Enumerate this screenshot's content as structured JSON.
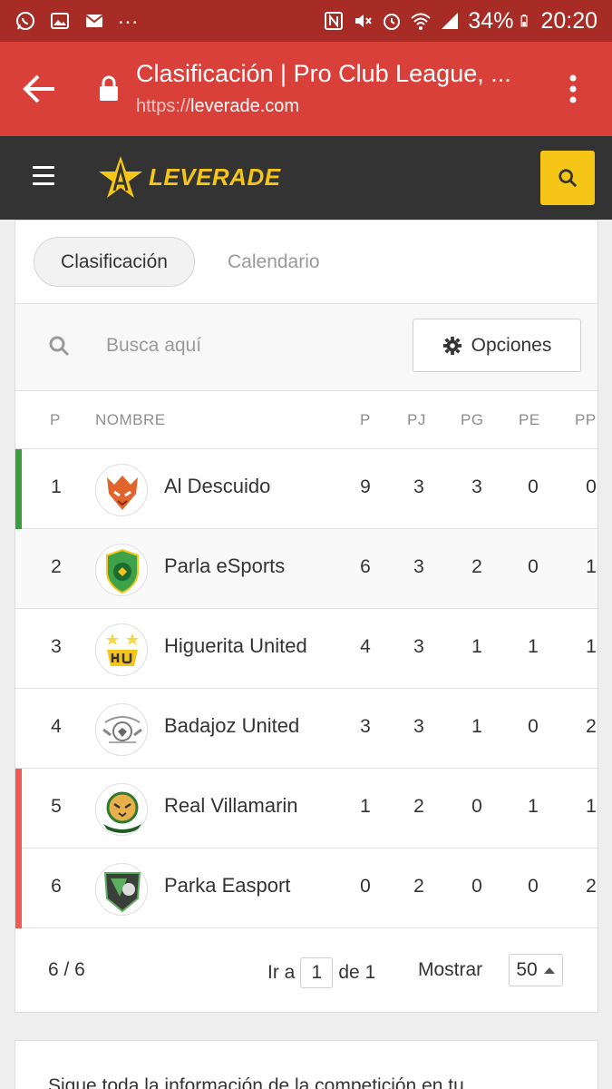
{
  "status": {
    "battery": "34%",
    "time": "20:20",
    "dots": "..."
  },
  "browser": {
    "title": "Clasificación | Pro Club League, ...",
    "url_scheme": "https://",
    "url_host": "leverade.com"
  },
  "site": {
    "logo_text": "LEVERADE",
    "accent": "#f5c518"
  },
  "tabs": [
    {
      "label": "Clasificación"
    },
    {
      "label": "Calendario"
    }
  ],
  "search": {
    "placeholder": "Busca aquí"
  },
  "options": {
    "label": "Opciones"
  },
  "table": {
    "headers": [
      "P",
      "NOMBRE",
      "P",
      "PJ",
      "PG",
      "PE",
      "PP"
    ],
    "rows": [
      {
        "pos": "1",
        "name": "Al Descuido",
        "p": "9",
        "pj": "3",
        "pg": "3",
        "pe": "0",
        "pp": "0",
        "zone": "#3a9c3a",
        "crest": "tiger"
      },
      {
        "pos": "2",
        "name": "Parla eSports",
        "p": "6",
        "pj": "3",
        "pg": "2",
        "pe": "0",
        "pp": "1",
        "zone": "",
        "crest": "shield-green"
      },
      {
        "pos": "3",
        "name": "Higuerita United",
        "p": "4",
        "pj": "3",
        "pg": "1",
        "pe": "1",
        "pp": "1",
        "zone": "",
        "crest": "hu-badge"
      },
      {
        "pos": "4",
        "name": "Badajoz United",
        "p": "3",
        "pj": "3",
        "pg": "1",
        "pe": "0",
        "pp": "2",
        "zone": "",
        "crest": "grey-crest"
      },
      {
        "pos": "5",
        "name": "Real Villamarin",
        "p": "1",
        "pj": "2",
        "pg": "0",
        "pe": "1",
        "pp": "1",
        "zone": "#f05a56",
        "crest": "tiger-green"
      },
      {
        "pos": "6",
        "name": "Parka Easport",
        "p": "0",
        "pj": "2",
        "pg": "0",
        "pe": "0",
        "pp": "2",
        "zone": "#f05a56",
        "crest": "dark-shield"
      }
    ]
  },
  "pagination": {
    "count": "6 / 6",
    "goto_label": "Ir a",
    "page": "1",
    "of_label": "de 1",
    "show_label": "Mostrar",
    "show_value": "50"
  },
  "info": {
    "text": "Sigue toda la información de la competición en tu"
  }
}
